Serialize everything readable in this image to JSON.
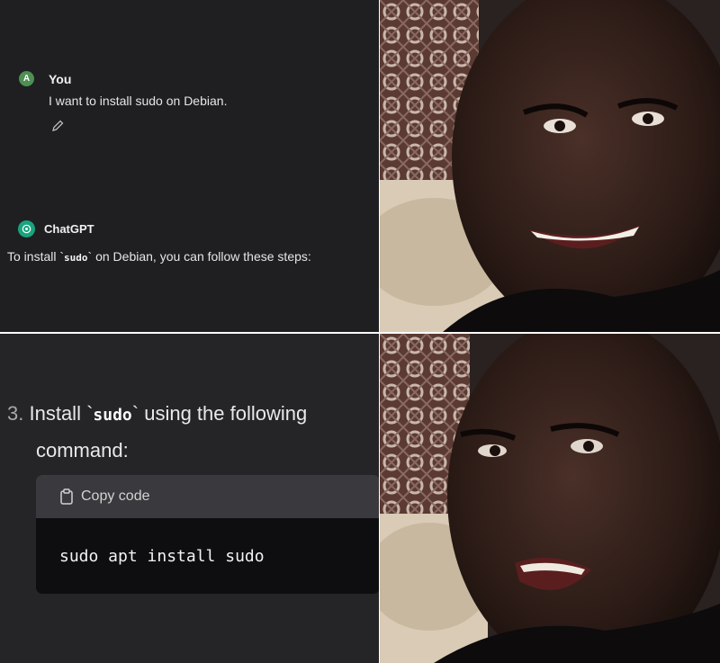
{
  "chat": {
    "user_avatar_letter": "A",
    "user_name": "You",
    "user_message": "I want to install sudo on Debian.",
    "assistant_name": "ChatGPT",
    "assistant_reply_before": "To install `",
    "assistant_reply_code": "sudo",
    "assistant_reply_after": "` on Debian, you can follow these steps:"
  },
  "step": {
    "number": "3.",
    "text_before": "Install `",
    "code": "sudo",
    "text_after": "` using the following",
    "line2": "command:"
  },
  "code_block": {
    "copy_label": "Copy code",
    "command": "sudo apt install sudo"
  },
  "colors": {
    "chat_bg": "#1f1f22",
    "user_avatar": "#4e8f54",
    "chatgpt_icon": "#19a47f",
    "code_bg": "#0e0e10",
    "code_header": "#3a393d"
  }
}
